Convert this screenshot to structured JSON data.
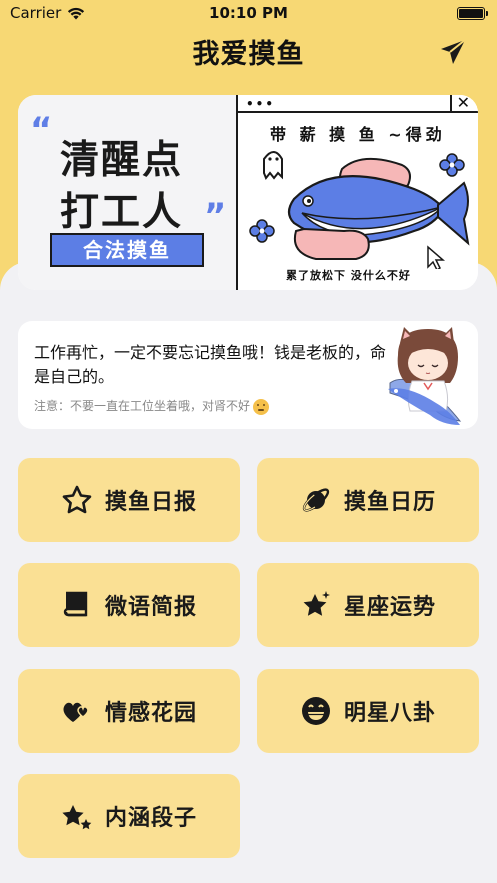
{
  "status": {
    "carrier": "Carrier",
    "time": "10:10 PM"
  },
  "nav": {
    "title": "我爱摸鱼"
  },
  "banner": {
    "slogan_line1": "清醒点",
    "slogan_line2": "打工人",
    "quote_open": "“",
    "quote_close": "”",
    "legal_tag": "合法摸鱼",
    "fish_title": "带 薪 摸 鱼 ~得劲",
    "fish_caption": "累了放松下 没什么不好",
    "window_dots": "•••",
    "window_close": "✕"
  },
  "tip": {
    "main": "工作再忙，一定不要忘记摸鱼哦！钱是老板的，命是自己的。",
    "note": "注意：不要一直在工位坐着哦，对肾不好"
  },
  "menu": {
    "items": [
      {
        "label": "摸鱼日报",
        "icon": "star-outline-icon"
      },
      {
        "label": "摸鱼日历",
        "icon": "planet-icon"
      },
      {
        "label": "微语简报",
        "icon": "book-icon"
      },
      {
        "label": "星座运势",
        "icon": "star-sparkle-icon"
      },
      {
        "label": "情感花园",
        "icon": "hearts-icon"
      },
      {
        "label": "明星八卦",
        "icon": "grin-face-icon"
      },
      {
        "label": "内涵段子",
        "icon": "stars-icon"
      }
    ]
  },
  "colors": {
    "header_bg": "#f7d874",
    "button_bg": "#fae094",
    "accent_blue": "#5c7ee5",
    "page_bg": "#f1f1f4"
  }
}
